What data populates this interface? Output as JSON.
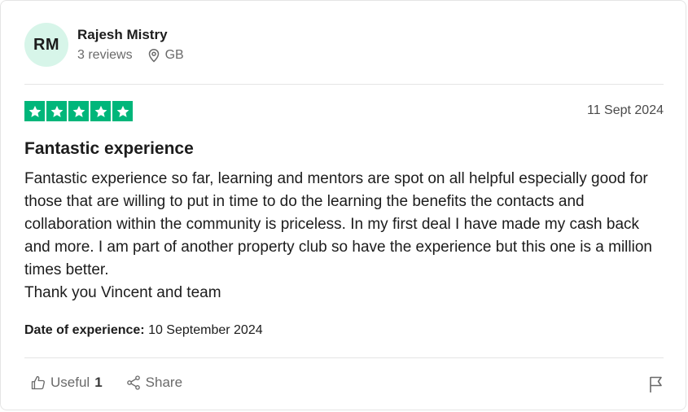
{
  "reviewer": {
    "initials": "RM",
    "name": "Rajesh Mistry",
    "reviews": "3 reviews",
    "country": "GB"
  },
  "review": {
    "rating": 5,
    "date": "11 Sept 2024",
    "title": "Fantastic experience",
    "body_lines": [
      "Fantastic experience so far, learning and mentors are spot on all helpful especially good for those that are willing to put in time to do the learning the benefits the contacts and collaboration within the community is priceless. In my first deal I have made my cash back and more. I am part of another property club so have the experience but this one is a million times better.",
      "Thank you Vincent and team"
    ],
    "experience_label": "Date of experience:",
    "experience_date": "10 September 2024"
  },
  "actions": {
    "useful_label": "Useful",
    "useful_count": "1",
    "share_label": "Share"
  },
  "colors": {
    "star_green": "#00b67a",
    "avatar_bg": "#d7f5e9"
  },
  "icons": [
    "location-pin-icon",
    "star-icon",
    "thumbs-up-icon",
    "share-icon",
    "flag-icon"
  ]
}
